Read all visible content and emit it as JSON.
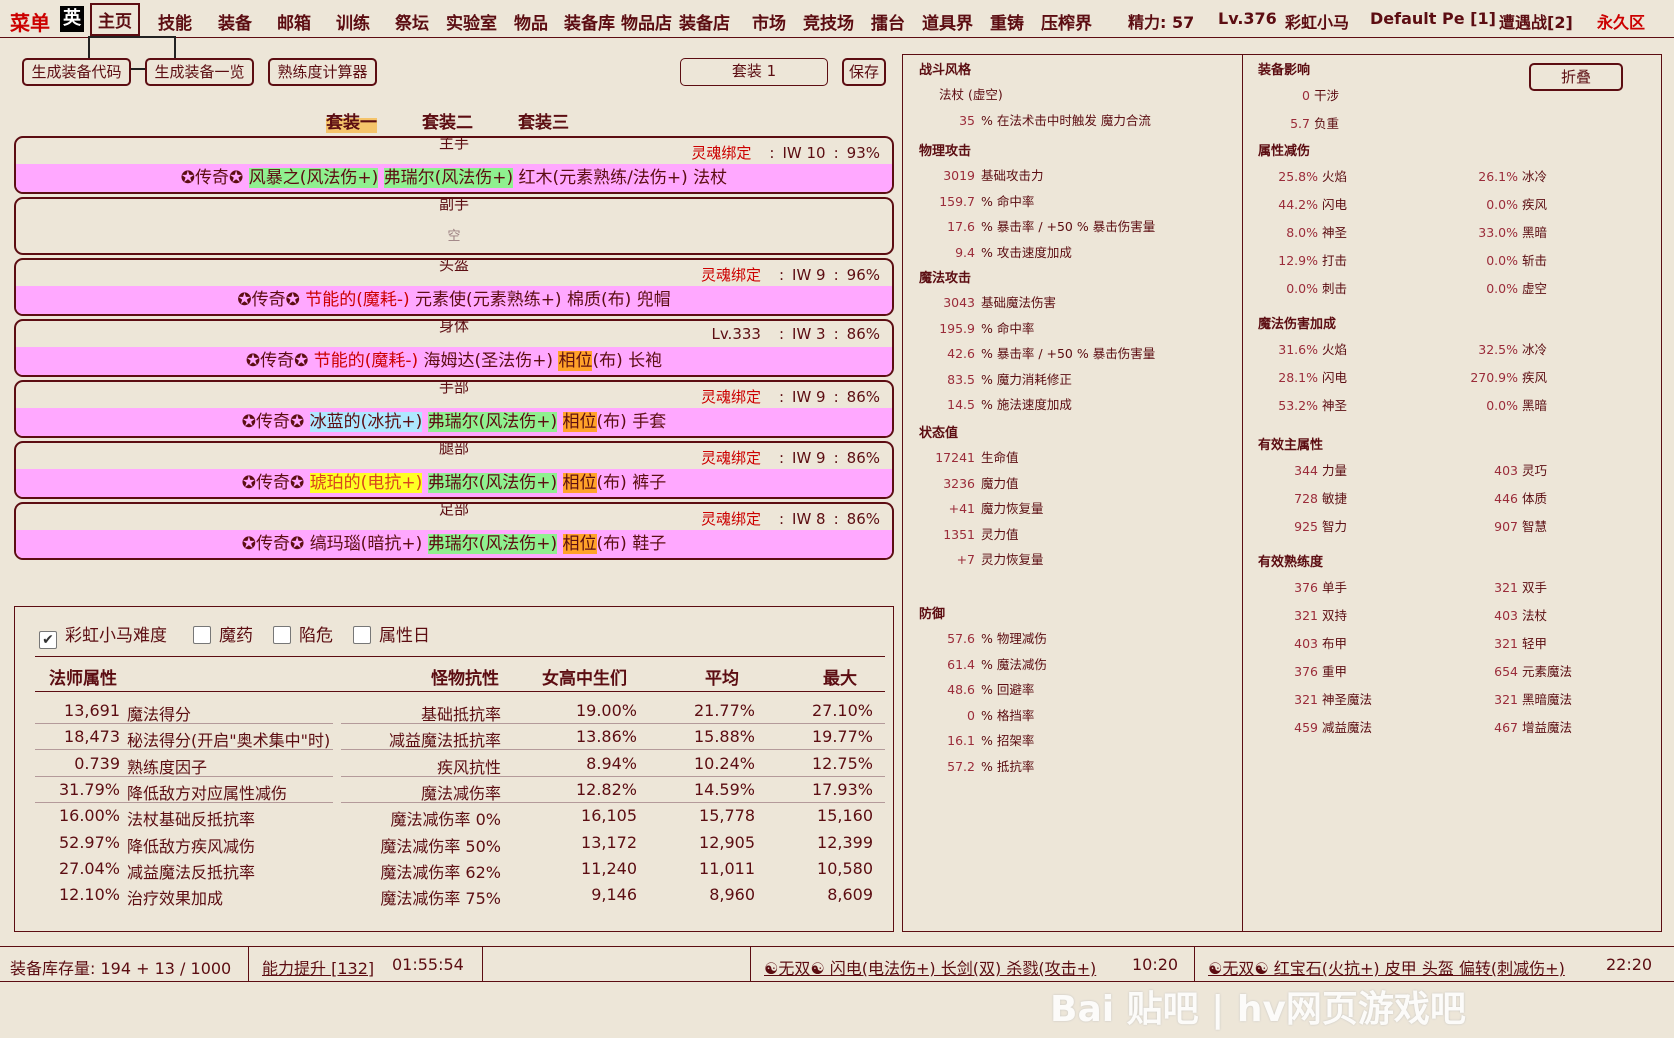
{
  "menu": {
    "title": "菜单",
    "lang": "英",
    "nav": [
      "主页",
      "技能",
      "装备",
      "邮箱",
      "训练",
      "祭坛",
      "实验室",
      "物品",
      "装备库",
      "物品店",
      "装备店",
      "市场",
      "竞技场",
      "擂台",
      "道具界",
      "重铸",
      "压榨界"
    ],
    "stamina": "精力: 57",
    "level": "Lv.376",
    "difficulty": "彩虹小马",
    "persona": "Default Pe [1]",
    "encounter": "遭遇战[2]",
    "zone": "永久区"
  },
  "toolbar": {
    "gen_code": "生成装备代码",
    "gen_list": "生成装备一览",
    "proficiency_calc": "熟练度计算器",
    "set_name": "套装 1",
    "save": "保存"
  },
  "set_tabs": [
    "套装一",
    "套装二",
    "套装三"
  ],
  "slots": [
    {
      "label": "主手",
      "soul": "灵魂绑定",
      "iw": "IW 10",
      "pct": "93%",
      "parts": [
        {
          "t": "✪传奇✪ ",
          "c": ""
        },
        {
          "t": "风暴之(风法伤+)",
          "c": "hl-green"
        },
        {
          "t": " ",
          "c": ""
        },
        {
          "t": "弗瑞尔(风法伤+)",
          "c": "hl-green"
        },
        {
          "t": " 红木(元素熟练/法伤+) 法杖",
          "c": ""
        }
      ]
    },
    {
      "label": "副手",
      "empty": "空"
    },
    {
      "label": "头盔",
      "soul": "灵魂绑定",
      "iw": "IW 9",
      "pct": "96%",
      "parts": [
        {
          "t": "✪传奇✪ ",
          "c": ""
        },
        {
          "t": "节能的(魔耗-)",
          "c": "txt-red"
        },
        {
          "t": " 元素使(元素熟练+) 棉质(布) 兜帽",
          "c": ""
        }
      ]
    },
    {
      "label": "身体",
      "soul": "Lv.333",
      "iw": "IW 3",
      "pct": "86%",
      "parts": [
        {
          "t": "✪传奇✪ ",
          "c": ""
        },
        {
          "t": "节能的(魔耗-)",
          "c": "txt-red"
        },
        {
          "t": " 海姆达(圣法伤+) ",
          "c": ""
        },
        {
          "t": "相位",
          "c": "hl-orange"
        },
        {
          "t": "(布) 长袍",
          "c": ""
        }
      ]
    },
    {
      "label": "手部",
      "soul": "灵魂绑定",
      "iw": "IW 9",
      "pct": "86%",
      "parts": [
        {
          "t": "✪传奇✪ ",
          "c": ""
        },
        {
          "t": "冰蓝的(冰抗+)",
          "c": "hl-cyan"
        },
        {
          "t": " ",
          "c": ""
        },
        {
          "t": "弗瑞尔(风法伤+)",
          "c": "hl-green"
        },
        {
          "t": " ",
          "c": ""
        },
        {
          "t": "相位",
          "c": "hl-orange"
        },
        {
          "t": "(布) 手套",
          "c": ""
        }
      ]
    },
    {
      "label": "腿部",
      "soul": "灵魂绑定",
      "iw": "IW 9",
      "pct": "86%",
      "parts": [
        {
          "t": "✪传奇✪ ",
          "c": ""
        },
        {
          "t": "琥珀的(电抗+)",
          "c": "hl-yellow"
        },
        {
          "t": " ",
          "c": ""
        },
        {
          "t": "弗瑞尔(风法伤+)",
          "c": "hl-green"
        },
        {
          "t": " ",
          "c": ""
        },
        {
          "t": "相位",
          "c": "hl-orange"
        },
        {
          "t": "(布) 裤子",
          "c": ""
        }
      ]
    },
    {
      "label": "足部",
      "soul": "灵魂绑定",
      "iw": "IW 8",
      "pct": "86%",
      "parts": [
        {
          "t": "✪传奇✪ ",
          "c": ""
        },
        {
          "t": "缟玛瑙(暗抗+)",
          "c": ""
        },
        {
          "t": " ",
          "c": ""
        },
        {
          "t": "弗瑞尔(风法伤+)",
          "c": "hl-green"
        },
        {
          "t": " ",
          "c": ""
        },
        {
          "t": "相位",
          "c": "hl-orange"
        },
        {
          "t": "(布) 鞋子",
          "c": ""
        }
      ]
    }
  ],
  "calc": {
    "checks": [
      {
        "label": "彩虹小马难度",
        "checked": true
      },
      {
        "label": "魔药",
        "checked": false
      },
      {
        "label": "陷危",
        "checked": false
      },
      {
        "label": "属性日",
        "checked": false
      }
    ],
    "headers": [
      "法师属性",
      "怪物抗性",
      "女高中生们",
      "平均",
      "最大"
    ],
    "mage_rows": [
      {
        "val": "13,691",
        "label": "魔法得分"
      },
      {
        "val": "18,473",
        "label": "秘法得分(开启\"奥术集中\"时)"
      },
      {
        "val": "0.739",
        "label": "熟练度因子"
      },
      {
        "val": "31.79%",
        "label": "降低敌方对应属性减伤"
      },
      {
        "val": "16.00%",
        "label": "法杖基础反抵抗率"
      },
      {
        "val": "52.97%",
        "label": "降低敌方疾风减伤"
      },
      {
        "val": "27.04%",
        "label": "减益魔法反抵抗率"
      },
      {
        "val": "12.10%",
        "label": "治疗效果加成"
      }
    ],
    "monster_rows": [
      {
        "label": "基础抵抗率",
        "a": "19.00%",
        "b": "21.77%",
        "c": "27.10%"
      },
      {
        "label": "减益魔法抵抗率",
        "a": "13.86%",
        "b": "15.88%",
        "c": "19.77%"
      },
      {
        "label": "疾风抗性",
        "a": "8.94%",
        "b": "10.24%",
        "c": "12.75%"
      },
      {
        "label": "魔法减伤率",
        "a": "12.82%",
        "b": "14.59%",
        "c": "17.93%"
      },
      {
        "label": "魔法减伤率 0%",
        "a": "16,105",
        "b": "15,778",
        "c": "15,160"
      },
      {
        "label": "魔法减伤率 50%",
        "a": "13,172",
        "b": "12,905",
        "c": "12,399"
      },
      {
        "label": "魔法减伤率 62%",
        "a": "11,240",
        "b": "11,011",
        "c": "10,580"
      },
      {
        "label": "魔法减伤率 75%",
        "a": "9,146",
        "b": "8,960",
        "c": "8,609"
      }
    ]
  },
  "right_left": {
    "fight_style": {
      "title": "战斗风格",
      "items": [
        {
          "v": "",
          "t": "法杖 (虚空)"
        },
        {
          "v": "35",
          "t": "% 在法术击中时触发 魔力合流"
        }
      ]
    },
    "phys_attack": {
      "title": "物理攻击",
      "items": [
        {
          "v": "3019",
          "t": "基础攻击力"
        },
        {
          "v": "159.7",
          "t": "% 命中率"
        },
        {
          "v": "17.6",
          "t": "% 暴击率 / +50 % 暴击伤害量"
        },
        {
          "v": "9.4",
          "t": "% 攻击速度加成"
        }
      ]
    },
    "mag_attack": {
      "title": "魔法攻击",
      "items": [
        {
          "v": "3043",
          "t": "基础魔法伤害"
        },
        {
          "v": "195.9",
          "t": "% 命中率"
        },
        {
          "v": "42.6",
          "t": "% 暴击率 / +50 % 暴击伤害量"
        },
        {
          "v": "83.5",
          "t": "% 魔力消耗修正"
        },
        {
          "v": "14.5",
          "t": "% 施法速度加成"
        }
      ]
    },
    "status": {
      "title": "状态值",
      "items": [
        {
          "v": "17241",
          "t": "生命值"
        },
        {
          "v": "3236",
          "t": "魔力值"
        },
        {
          "v": "+41",
          "t": "魔力恢复量"
        },
        {
          "v": "1351",
          "t": "灵力值"
        },
        {
          "v": "+7",
          "t": "灵力恢复量"
        }
      ]
    },
    "defense": {
      "title": "防御",
      "items": [
        {
          "v": "57.6",
          "t": "% 物理减伤"
        },
        {
          "v": "61.4",
          "t": "% 魔法减伤"
        },
        {
          "v": "48.6",
          "t": "% 回避率"
        },
        {
          "v": "0",
          "t": "% 格挡率"
        },
        {
          "v": "16.1",
          "t": "% 招架率"
        },
        {
          "v": "57.2",
          "t": "% 抵抗率"
        }
      ]
    }
  },
  "right_right": {
    "fold": "折叠",
    "equip_effect": {
      "title": "装备影响",
      "items": [
        {
          "v": "0",
          "t": "干涉"
        },
        {
          "v": "5.7",
          "t": "负重"
        }
      ]
    },
    "attr_reduce": {
      "title": "属性减伤",
      "items": [
        {
          "v": "25.8%",
          "t": "火焰"
        },
        {
          "v": "26.1%",
          "t": "冰冷"
        },
        {
          "v": "44.2%",
          "t": "闪电"
        },
        {
          "v": "0.0%",
          "t": "疾风"
        },
        {
          "v": "8.0%",
          "t": "神圣"
        },
        {
          "v": "33.0%",
          "t": "黑暗"
        },
        {
          "v": "12.9%",
          "t": "打击"
        },
        {
          "v": "0.0%",
          "t": "斩击"
        },
        {
          "v": "0.0%",
          "t": "刺击"
        },
        {
          "v": "0.0%",
          "t": "虚空"
        }
      ]
    },
    "mag_bonus": {
      "title": "魔法伤害加成",
      "items": [
        {
          "v": "31.6%",
          "t": "火焰"
        },
        {
          "v": "32.5%",
          "t": "冰冷"
        },
        {
          "v": "28.1%",
          "t": "闪电"
        },
        {
          "v": "270.9%",
          "t": "疾风"
        },
        {
          "v": "53.2%",
          "t": "神圣"
        },
        {
          "v": "0.0%",
          "t": "黑暗"
        }
      ]
    },
    "main_attr": {
      "title": "有效主属性",
      "items": [
        {
          "v": "344",
          "t": "力量"
        },
        {
          "v": "403",
          "t": "灵巧"
        },
        {
          "v": "728",
          "t": "敏捷"
        },
        {
          "v": "446",
          "t": "体质"
        },
        {
          "v": "925",
          "t": "智力"
        },
        {
          "v": "907",
          "t": "智慧"
        }
      ]
    },
    "proficiency": {
      "title": "有效熟练度",
      "items": [
        {
          "v": "376",
          "t": "单手"
        },
        {
          "v": "321",
          "t": "双手"
        },
        {
          "v": "321",
          "t": "双持"
        },
        {
          "v": "403",
          "t": "法杖"
        },
        {
          "v": "403",
          "t": "布甲"
        },
        {
          "v": "321",
          "t": "轻甲"
        },
        {
          "v": "376",
          "t": "重甲"
        },
        {
          "v": "654",
          "t": "元素魔法"
        },
        {
          "v": "321",
          "t": "神圣魔法"
        },
        {
          "v": "321",
          "t": "黑暗魔法"
        },
        {
          "v": "459",
          "t": "减益魔法"
        },
        {
          "v": "467",
          "t": "增益魔法"
        }
      ]
    }
  },
  "statusbar": {
    "storage": "装备库存量: 194 + 13 / 1000",
    "boost": "能力提升 [132]",
    "timer": "01:55:54",
    "msg1": "☯无双☯ 闪电(电法伤+) 长剑(双) 杀戮(攻击+)",
    "time1": "10:20",
    "msg2": "☯无双☯ 红宝石(火抗+) 皮甲 头盔 偏转(刺减伤+)",
    "time2": "22:20"
  },
  "watermark": "Bai 贴吧 | hv网页游戏吧"
}
